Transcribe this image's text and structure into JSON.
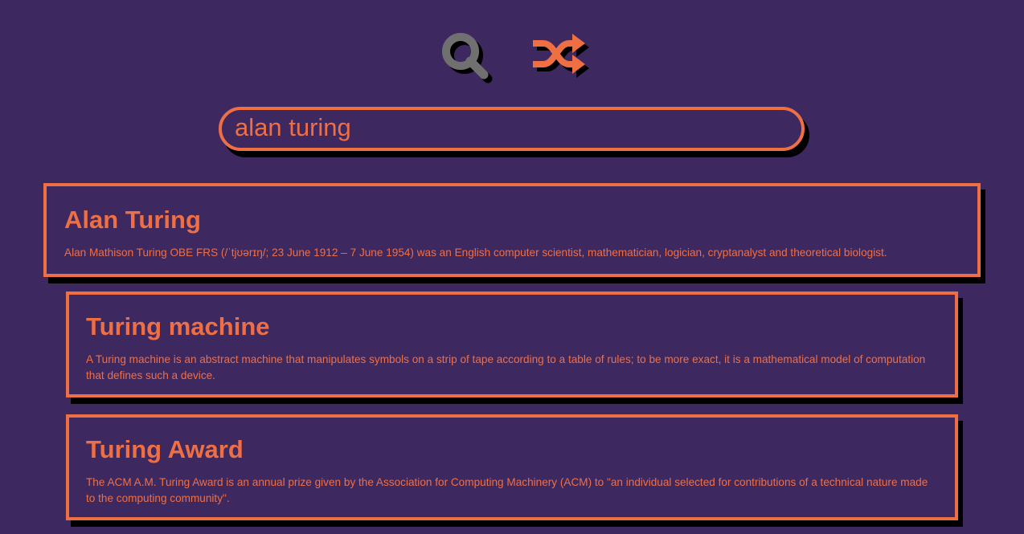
{
  "toolbar": {
    "search_icon": "magnifier-icon",
    "random_icon": "shuffle-icon",
    "colors": {
      "search_icon": "#707070",
      "accent": "#ef6f45",
      "background": "#3e2860",
      "shadow": "#000000"
    }
  },
  "search": {
    "value": "alan turing",
    "placeholder": ""
  },
  "results": [
    {
      "title": "Alan Turing",
      "snippet": "Alan Mathison Turing OBE FRS (/ˈtjʊərɪŋ/; 23 June 1912 – 7 June 1954) was an English computer scientist, mathematician, logician, cryptanalyst and theoretical biologist."
    },
    {
      "title": "Turing machine",
      "snippet": "A Turing machine is an abstract machine that manipulates symbols on a strip of tape according to a table of rules; to be more exact, it is a mathematical model of computation that defines such a device."
    },
    {
      "title": "Turing Award",
      "snippet": "The ACM A.M. Turing Award is an annual prize given by the Association for Computing Machinery (ACM) to \"an individual selected for contributions of a technical nature made to the computing community\"."
    }
  ]
}
